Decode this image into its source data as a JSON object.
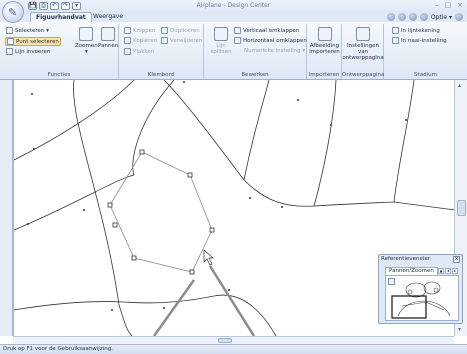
{
  "window": {
    "title": "Airplane - Design Center",
    "controls": [
      "–",
      "□",
      "×"
    ]
  },
  "quick_access": [
    "💾",
    "⎙",
    "↶",
    "↷",
    "▾"
  ],
  "tabs": [
    {
      "label": "Figuurhandvat",
      "active": true
    },
    {
      "label": "Weergave",
      "active": false
    }
  ],
  "tab_right": {
    "option_label": "Optie ▾"
  },
  "ribbon": {
    "functies": {
      "label": "Functies",
      "selecteren": "Selecteren ▾",
      "punt_selecteren": "Punt selecteren",
      "lijn_invoeren": "Lijn invoeren",
      "zoomen": "Zoomen",
      "pannen": "Pannen",
      "zoom_dropdown": "▾"
    },
    "klembord": {
      "label": "Klembord",
      "knippen": "Knippen",
      "kopieren": "Kopiëren",
      "plakken": "Plakken",
      "dupliceren": "Dupliceren",
      "verwijderen": "Verwijderen"
    },
    "bewerken": {
      "label": "Bewerken",
      "lijn_splitsen": "Lijn splitsen",
      "verticaal": "Verticaal omklappen",
      "horizontaal": "Horizontaal omklappen",
      "numeriek": "Numerieke instelling ▾"
    },
    "importeren": {
      "label": "Importeren",
      "afbeelding": "Afbeelding importeren"
    },
    "ontwerppagina": {
      "label": "Ontwerppagina",
      "instellingen": "Instellingen van ontwerppagina"
    },
    "stadium": {
      "label": "Stadium",
      "in_lijntekening": "In lijntekening",
      "in_naai_instelling": "In naai-instelling"
    }
  },
  "reference_window": {
    "title": "Referentievenster",
    "tab": "Pannen/Zoomen",
    "close": "×"
  },
  "status": {
    "text": "Druk op F1 voor de Gebruiksaanwijzing."
  },
  "colors": {
    "line": "#333333",
    "selected_line": "#8c8c8c",
    "ribbon_bg": "#dde7f4",
    "accent": "#fbe3a0"
  }
}
